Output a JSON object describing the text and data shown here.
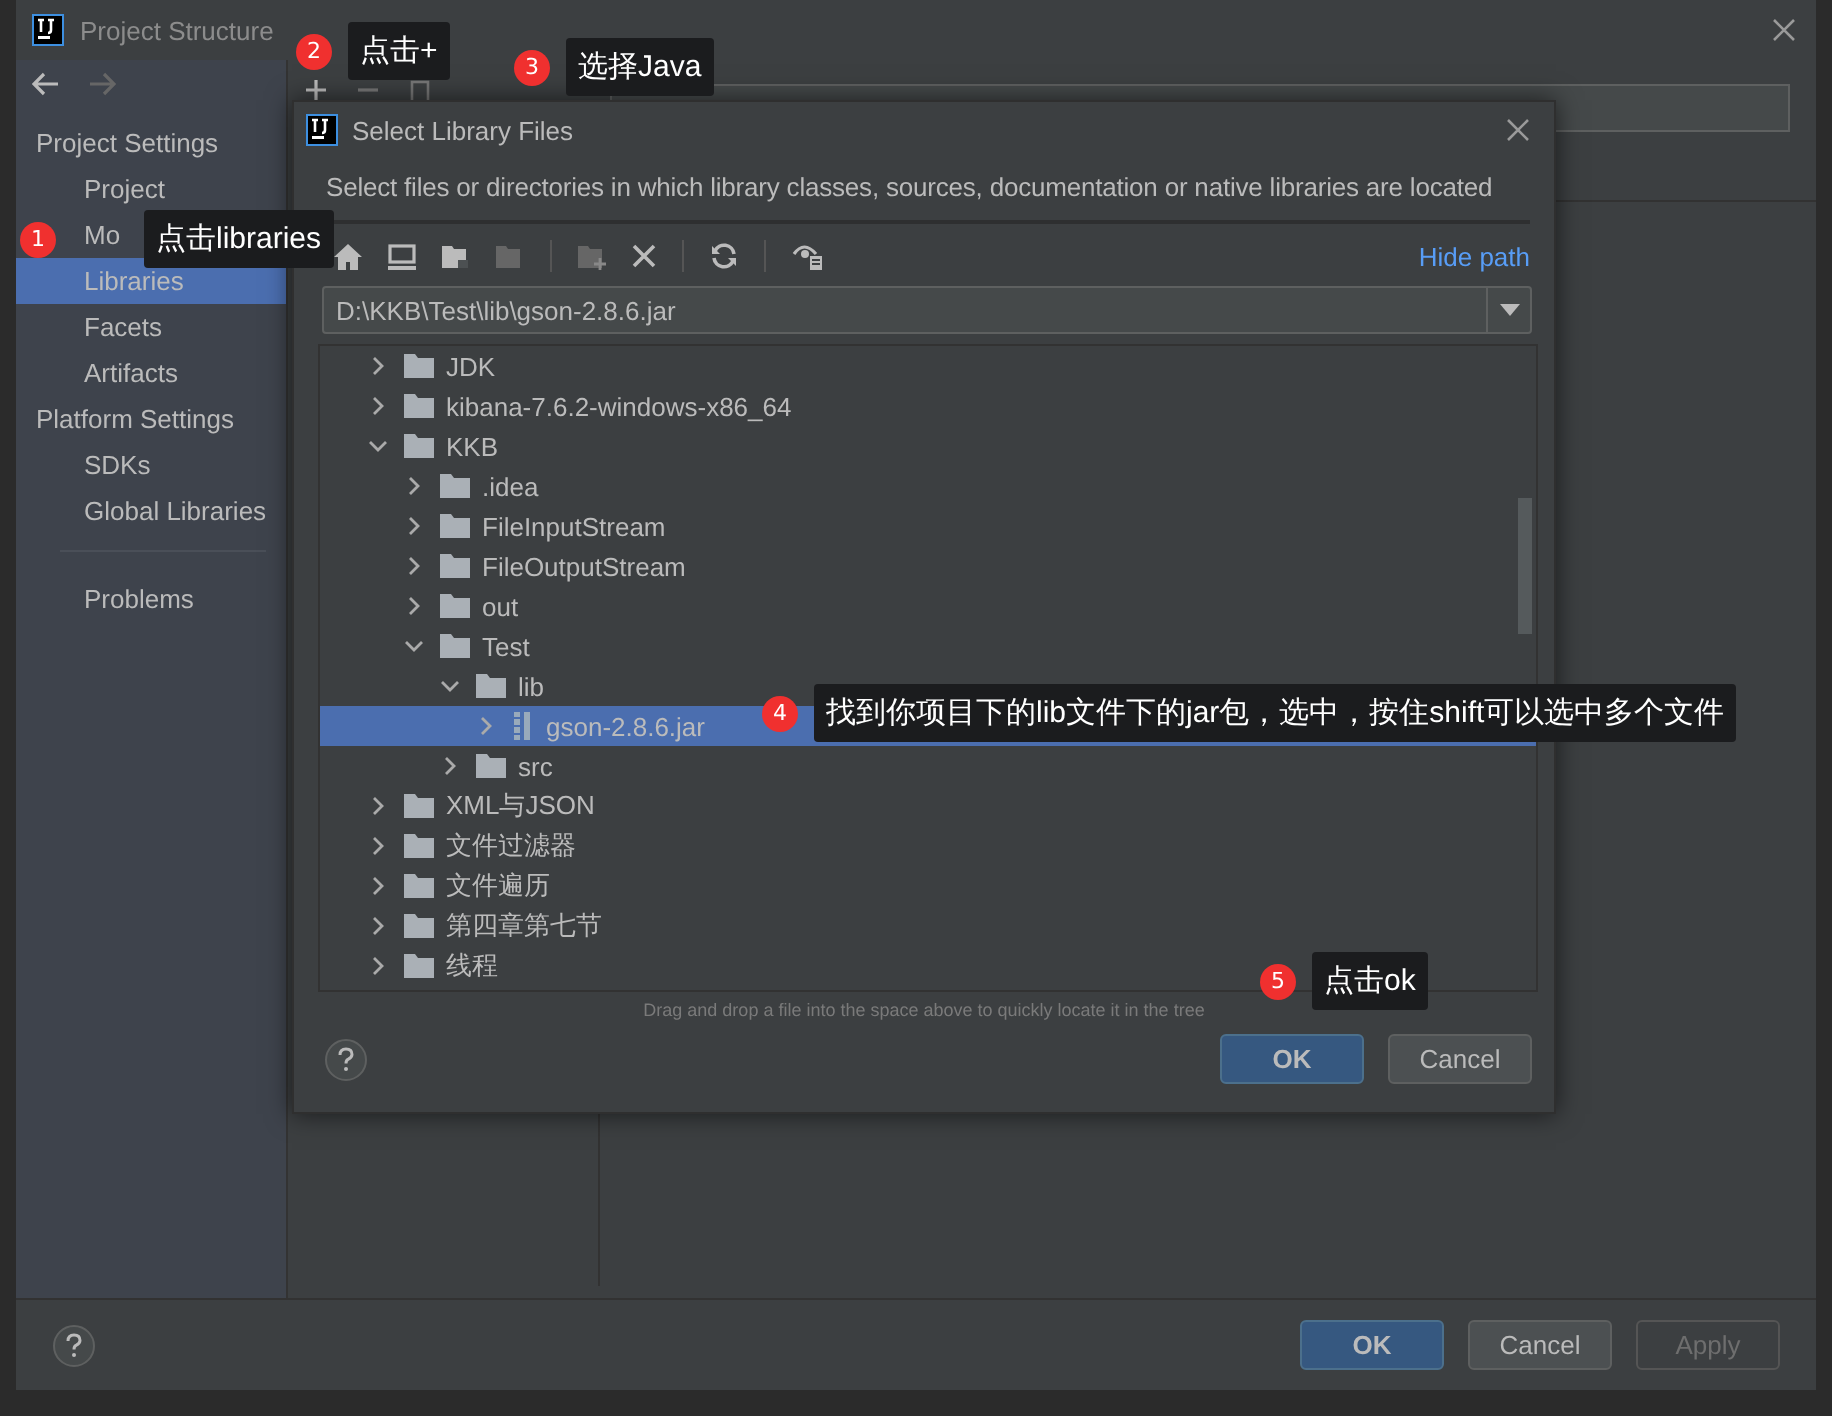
{
  "window": {
    "title": "Project Structure"
  },
  "sidebar": {
    "sections": [
      {
        "heading": "Project Settings",
        "items": [
          {
            "label": "Project",
            "selected": false
          },
          {
            "label": "Mo",
            "selected": false
          },
          {
            "label": "Libraries",
            "selected": true
          },
          {
            "label": "Facets",
            "selected": false
          },
          {
            "label": "Artifacts",
            "selected": false
          }
        ]
      },
      {
        "heading": "Platform Settings",
        "items": [
          {
            "label": "SDKs",
            "selected": false
          },
          {
            "label": "Global Libraries",
            "selected": false
          }
        ]
      }
    ],
    "footer_items": [
      {
        "label": "Problems",
        "selected": false
      }
    ]
  },
  "buttons": [
    {
      "label": "OK",
      "default": true,
      "disabled": false
    },
    {
      "label": "Cancel",
      "default": false,
      "disabled": false
    },
    {
      "label": "Apply",
      "default": false,
      "disabled": true
    }
  ],
  "dialog": {
    "title": "Select Library Files",
    "description": "Select files or directories in which library classes, sources, documentation or native libraries are located",
    "hide_path": "Hide path",
    "path": "D:\\KKB\\Test\\lib\\gson-2.8.6.jar",
    "tree": [
      {
        "label": "JDK",
        "kind": "folder",
        "expanded": false,
        "selected": false
      },
      {
        "label": "kibana-7.6.2-windows-x86_64",
        "kind": "folder",
        "expanded": false,
        "selected": false
      },
      {
        "label": "KKB",
        "kind": "folder",
        "expanded": true,
        "selected": false,
        "children": [
          {
            "label": ".idea",
            "kind": "folder",
            "expanded": false,
            "selected": false
          },
          {
            "label": "FileInputStream",
            "kind": "folder",
            "expanded": false,
            "selected": false
          },
          {
            "label": "FileOutputStream",
            "kind": "folder",
            "expanded": false,
            "selected": false
          },
          {
            "label": "out",
            "kind": "folder",
            "expanded": false,
            "selected": false
          },
          {
            "label": "Test",
            "kind": "folder",
            "expanded": true,
            "selected": false,
            "children": [
              {
                "label": "lib",
                "kind": "folder",
                "expanded": true,
                "selected": false,
                "children": [
                  {
                    "label": "gson-2.8.6.jar",
                    "kind": "jar",
                    "expanded": false,
                    "selected": true
                  }
                ]
              },
              {
                "label": "src",
                "kind": "folder",
                "expanded": false,
                "selected": false
              }
            ]
          }
        ]
      },
      {
        "label": "XML与JSON",
        "kind": "folder",
        "expanded": false,
        "selected": false
      },
      {
        "label": "文件过滤器",
        "kind": "folder",
        "expanded": false,
        "selected": false
      },
      {
        "label": "文件遍历",
        "kind": "folder",
        "expanded": false,
        "selected": false
      },
      {
        "label": "第四章第七节",
        "kind": "folder",
        "expanded": false,
        "selected": false
      },
      {
        "label": "线程",
        "kind": "folder",
        "expanded": false,
        "selected": false
      }
    ],
    "hint": "Drag and drop a file into the space above to quickly locate it in the tree",
    "buttons": [
      {
        "label": "OK",
        "default": true,
        "disabled": false
      },
      {
        "label": "Cancel",
        "default": false,
        "disabled": false
      }
    ]
  },
  "annotations": [
    {
      "number": "1",
      "text": "点击libraries"
    },
    {
      "number": "2",
      "text": "点击+"
    },
    {
      "number": "3",
      "text": "选择Java"
    },
    {
      "number": "4",
      "text": "找到你项目下的lib文件下的jar包，选中，按住shift可以选中多个文件"
    },
    {
      "number": "5",
      "text": "点击ok"
    }
  ]
}
